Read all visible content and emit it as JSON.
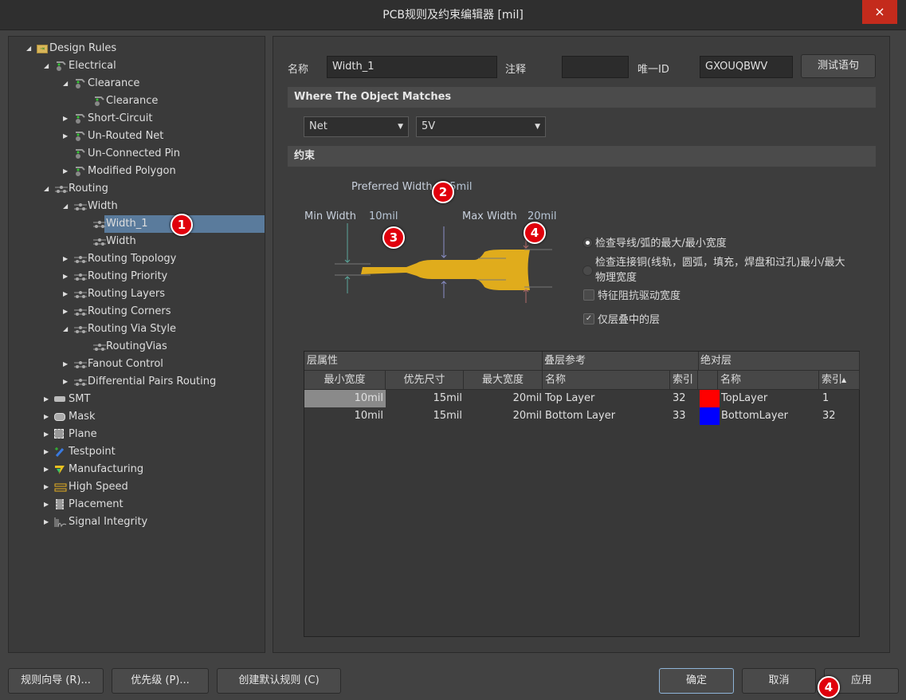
{
  "window": {
    "title": "PCB规则及约束编辑器 [mil]",
    "close_icon": "×"
  },
  "tree": [
    {
      "label": "Design Rules",
      "level": 0,
      "arrow": "expanded",
      "icon": "folder-rules-icon"
    },
    {
      "label": "Electrical",
      "level": 1,
      "arrow": "expanded",
      "icon": "electrical-rule-icon"
    },
    {
      "label": "Clearance",
      "level": 2,
      "arrow": "expanded",
      "icon": "electrical-rule-icon"
    },
    {
      "label": "Clearance",
      "level": 3,
      "arrow": "none",
      "icon": "electrical-rule-icon"
    },
    {
      "label": "Short-Circuit",
      "level": 2,
      "arrow": "collapsed",
      "icon": "electrical-rule-icon"
    },
    {
      "label": "Un-Routed Net",
      "level": 2,
      "arrow": "collapsed",
      "icon": "electrical-rule-icon"
    },
    {
      "label": "Un-Connected Pin",
      "level": 2,
      "arrow": "none",
      "icon": "electrical-rule-icon"
    },
    {
      "label": "Modified Polygon",
      "level": 2,
      "arrow": "collapsed",
      "icon": "electrical-rule-icon"
    },
    {
      "label": "Routing",
      "level": 1,
      "arrow": "expanded",
      "icon": "routing-rule-icon"
    },
    {
      "label": "Width",
      "level": 2,
      "arrow": "expanded",
      "icon": "routing-rule-icon"
    },
    {
      "label": "Width_1",
      "level": 3,
      "arrow": "none",
      "icon": "routing-rule-icon",
      "selected": true
    },
    {
      "label": "Width",
      "level": 3,
      "arrow": "none",
      "icon": "routing-rule-icon"
    },
    {
      "label": "Routing Topology",
      "level": 2,
      "arrow": "collapsed",
      "icon": "routing-rule-icon"
    },
    {
      "label": "Routing Priority",
      "level": 2,
      "arrow": "collapsed",
      "icon": "routing-rule-icon"
    },
    {
      "label": "Routing Layers",
      "level": 2,
      "arrow": "collapsed",
      "icon": "routing-rule-icon"
    },
    {
      "label": "Routing Corners",
      "level": 2,
      "arrow": "collapsed",
      "icon": "routing-rule-icon"
    },
    {
      "label": "Routing Via Style",
      "level": 2,
      "arrow": "expanded",
      "icon": "routing-rule-icon"
    },
    {
      "label": "RoutingVias",
      "level": 3,
      "arrow": "none",
      "icon": "routing-rule-icon"
    },
    {
      "label": "Fanout Control",
      "level": 2,
      "arrow": "collapsed",
      "icon": "routing-rule-icon"
    },
    {
      "label": "Differential Pairs Routing",
      "level": 2,
      "arrow": "collapsed",
      "icon": "routing-rule-icon"
    },
    {
      "label": "SMT",
      "level": 1,
      "arrow": "collapsed",
      "icon": "smt-icon"
    },
    {
      "label": "Mask",
      "level": 1,
      "arrow": "collapsed",
      "icon": "mask-icon"
    },
    {
      "label": "Plane",
      "level": 1,
      "arrow": "collapsed",
      "icon": "plane-icon"
    },
    {
      "label": "Testpoint",
      "level": 1,
      "arrow": "collapsed",
      "icon": "testpoint-icon"
    },
    {
      "label": "Manufacturing",
      "level": 1,
      "arrow": "collapsed",
      "icon": "manufacturing-icon"
    },
    {
      "label": "High Speed",
      "level": 1,
      "arrow": "collapsed",
      "icon": "high-speed-icon"
    },
    {
      "label": "Placement",
      "level": 1,
      "arrow": "collapsed",
      "icon": "placement-icon"
    },
    {
      "label": "Signal Integrity",
      "level": 1,
      "arrow": "collapsed",
      "icon": "signal-integrity-icon"
    }
  ],
  "rule": {
    "name_label": "名称",
    "name_value": "Width_1",
    "comment_label": "注释",
    "comment_value": "",
    "id_label": "唯一ID",
    "id_value": "GXOUQBWV",
    "test_button": "测试语句"
  },
  "where": {
    "header": "Where The Object Matches",
    "type": "Net",
    "value": "5V"
  },
  "constraints": {
    "header": "约束",
    "preferred_label": "Preferred Width",
    "preferred_value": "15mil",
    "min_label": "Min Width",
    "min_value": "10mil",
    "max_label": "Max Width",
    "max_value": "20mil",
    "trace_color": "#e0ac1c",
    "options": [
      {
        "type": "radio",
        "label": "检查导线/弧的最大/最小宽度",
        "checked": true
      },
      {
        "type": "radio",
        "label": "检查连接铜(线轨，圆弧，填充，焊盘和过孔)最小/最大",
        "label2": "物理宽度",
        "checked": false
      },
      {
        "type": "checkbox",
        "label": "特征阻抗驱动宽度",
        "checked": false
      },
      {
        "type": "checkbox",
        "label": "仅层叠中的层",
        "checked": true
      }
    ]
  },
  "table": {
    "groups": [
      "层属性",
      "叠层参考",
      "绝对层"
    ],
    "columns": [
      "最小宽度",
      "优先尺寸",
      "最大宽度",
      "名称",
      "索引",
      "",
      "名称",
      "索引"
    ],
    "rows": [
      {
        "min": "10mil",
        "pref": "15mil",
        "max": "20mil",
        "stack_name": "Top Layer",
        "stack_index": "32",
        "color": "#ff0000",
        "layer_name": "TopLayer",
        "layer_index": "1"
      },
      {
        "min": "10mil",
        "pref": "15mil",
        "max": "20mil",
        "stack_name": "Bottom Layer",
        "stack_index": "33",
        "color": "#0000ff",
        "layer_name": "BottomLayer",
        "layer_index": "32"
      }
    ]
  },
  "annotations": [
    "1",
    "2",
    "3",
    "4",
    "4"
  ],
  "footer": {
    "wizard": "规则向导 (R)...",
    "priority": "优先级 (P)...",
    "create_default": "创建默认规则 (C)",
    "ok": "确定",
    "cancel": "取消",
    "apply": "应用"
  }
}
